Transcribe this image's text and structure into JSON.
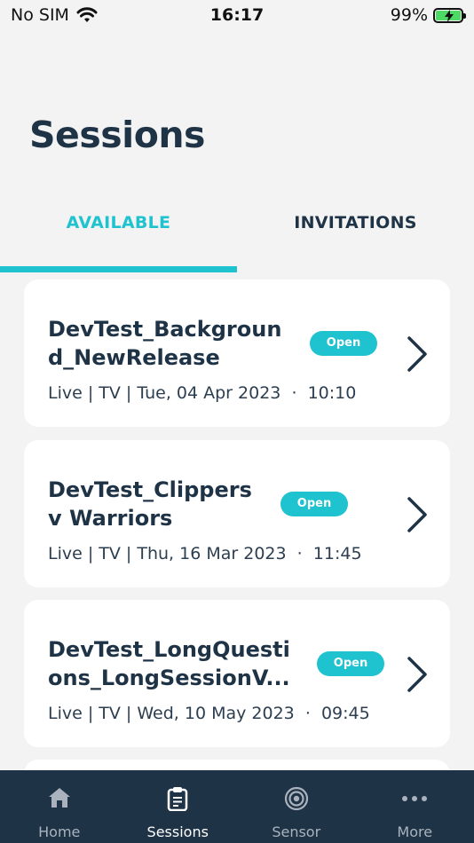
{
  "status_bar": {
    "carrier": "No SIM",
    "time": "16:17",
    "battery": "99%"
  },
  "header": {
    "title": "Sessions"
  },
  "tabs": [
    {
      "label": "AVAILABLE",
      "active": true
    },
    {
      "label": "INVITATIONS",
      "active": false
    }
  ],
  "sessions": [
    {
      "title": "DevTest_Backgroun\nd_NewRelease",
      "status": "Open",
      "meta": "Live | TV | Tue, 04 Apr 2023  ·  10:10"
    },
    {
      "title": "DevTest_Clippers\nv Warriors",
      "status": "Open",
      "meta": "Live | TV | Thu, 16 Mar 2023  ·  11:45"
    },
    {
      "title": "DevTest_LongQuesti\nons_LongSessionV...",
      "status": "Open",
      "meta": "Live | TV | Wed, 10 May 2023  ·  09:45"
    }
  ],
  "bottom_nav": [
    {
      "label": "Home",
      "icon": "home-icon",
      "active": false
    },
    {
      "label": "Sessions",
      "icon": "clipboard-icon",
      "active": true
    },
    {
      "label": "Sensor",
      "icon": "sensor-icon",
      "active": false
    },
    {
      "label": "More",
      "icon": "more-icon",
      "active": false
    }
  ],
  "colors": {
    "accent": "#1fc2cf",
    "navy": "#1f3347",
    "background": "#f3f3f3"
  }
}
